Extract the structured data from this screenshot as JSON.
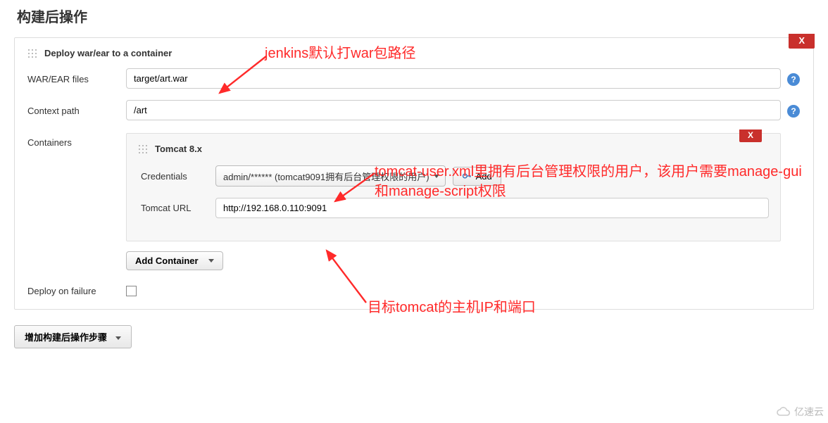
{
  "page": {
    "title": "构建后操作"
  },
  "section": {
    "title": "Deploy war/ear to a container",
    "close": "X"
  },
  "fields": {
    "war_ear_label": "WAR/EAR files",
    "war_ear_value": "target/art.war",
    "context_path_label": "Context path",
    "context_path_value": "/art",
    "containers_label": "Containers",
    "deploy_on_failure_label": "Deploy on failure"
  },
  "container": {
    "title": "Tomcat 8.x",
    "close": "X",
    "credentials_label": "Credentials",
    "credentials_selected": "admin/****** (tomcat9091拥有后台管理权限的用户)",
    "add_button": "Add",
    "tomcat_url_label": "Tomcat URL",
    "tomcat_url_value": "http://192.168.0.110:9091",
    "add_container_button": "Add Container"
  },
  "bottom": {
    "add_post_build_step": "增加构建后操作步骤"
  },
  "annotations": {
    "a1": "jenkins默认打war包路径",
    "a2": "tomcat-user.xml里拥有后台管理权限的用户，该用户需要manage-gui和manage-script权限",
    "a3": "目标tomcat的主机IP和端口"
  },
  "footer": {
    "brand": "亿速云"
  }
}
